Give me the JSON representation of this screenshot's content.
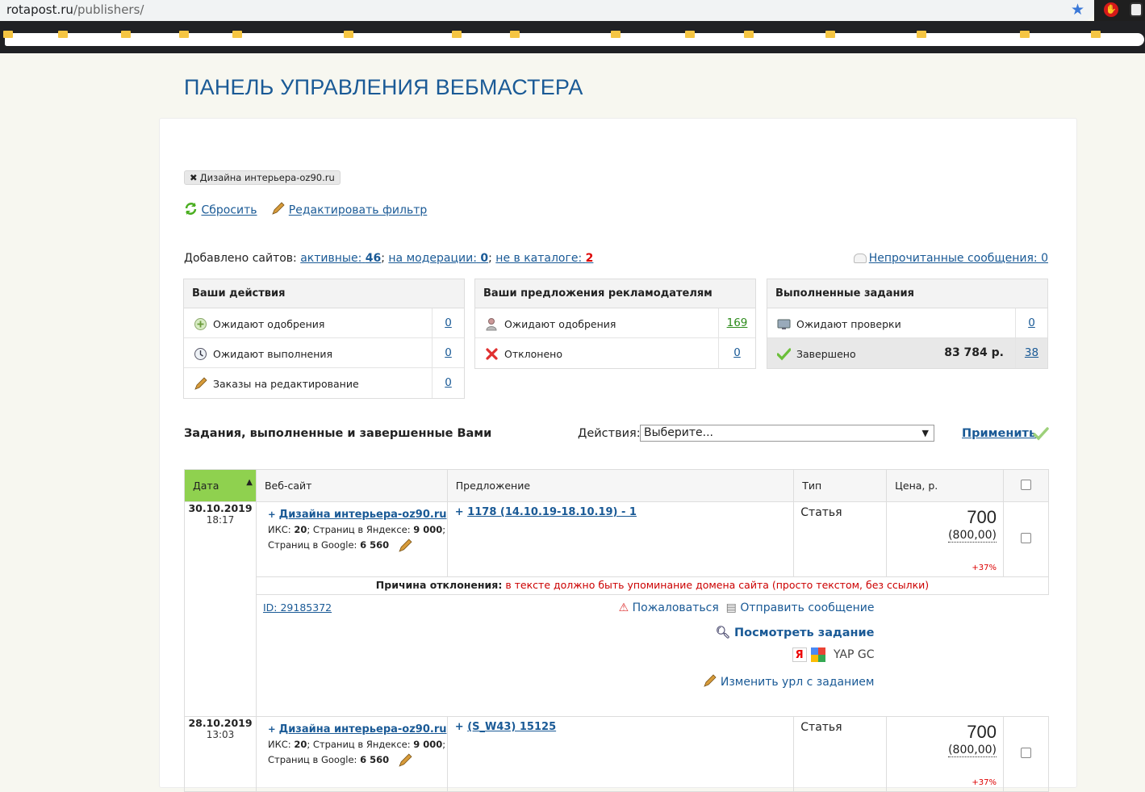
{
  "browser": {
    "url_host": "rotapost.ru",
    "url_path": "/publishers/"
  },
  "page": {
    "title": "ПАНЕЛЬ УПРАВЛЕНИЯ ВЕБМАСТЕРА"
  },
  "filter": {
    "tag": "Дизайна интерьера-oz90.ru",
    "reset": "Сбросить",
    "edit": "Редактировать фильтр"
  },
  "sites": {
    "label": "Добавлено сайтов:",
    "active_label": "активные:",
    "active_count": "46",
    "moderation_label": "на модерации:",
    "moderation_count": "0",
    "catalog_label": "не в каталоге:",
    "catalog_count": "2",
    "sep": ";"
  },
  "messages": {
    "unread": "Непрочитанные сообщения: 0"
  },
  "box_actions": {
    "title": "Ваши действия",
    "rows": [
      {
        "label": "Ожидают одобрения",
        "count": "0"
      },
      {
        "label": "Ожидают выполнения",
        "count": "0"
      },
      {
        "label": "Заказы на редактирование",
        "count": "0"
      }
    ]
  },
  "box_offers": {
    "title": "Ваши предложения рекламодателям",
    "rows": [
      {
        "label": "Ожидают одобрения",
        "count": "169"
      },
      {
        "label": "Отклонено",
        "count": "0"
      }
    ]
  },
  "box_done": {
    "title": "Выполненные задания",
    "rows": [
      {
        "label": "Ожидают проверки",
        "count": "0"
      },
      {
        "label": "Завершено",
        "sum": "83 784 р.",
        "count": "38"
      }
    ]
  },
  "tasks": {
    "heading": "Задания, выполненные и завершенные Вами",
    "actions_label": "Действия:",
    "select_value": "Выберите...",
    "apply": "Применить"
  },
  "table": {
    "columns": [
      "Дата",
      "Веб-сайт",
      "Предложение",
      "Тип",
      "Цена, р."
    ],
    "rows": [
      {
        "date": "30.10.2019",
        "time": "18:17",
        "site": "Дизайна интерьера-oz90.ru",
        "iks_label": "ИКС:",
        "iks": "20",
        "yandex_label": "Страниц в Яндексе:",
        "yandex": "9 000",
        "google_label": "Страниц в Google:",
        "google": "6 560",
        "offer": "1178 (14.10.19-18.10.19) - 1",
        "type": "Статья",
        "price": "700",
        "old_price": "(800,00)",
        "pct": "+37%",
        "reason_label": "Причина отклонения:",
        "reason": "в тексте должно быть упоминание домена сайта (просто текстом, без ссылки)",
        "id": "ID: 29185372",
        "complain": "Пожаловаться",
        "send_msg": "Отправить сообщение",
        "view": "Посмотреть задание",
        "badges_text": "YAP GC",
        "change_url": "Изменить урл с заданием"
      },
      {
        "date": "28.10.2019",
        "time": "13:03",
        "site": "Дизайна интерьера-oz90.ru",
        "iks_label": "ИКС:",
        "iks": "20",
        "yandex_label": "Страниц в Яндексе:",
        "yandex": "9 000",
        "google_label": "Страниц в Google:",
        "google": "6 560",
        "offer": "(S_W43) 15125",
        "type": "Статья",
        "price": "700",
        "old_price": "(800,00)",
        "pct": "+37%"
      }
    ]
  },
  "colors": {
    "link": "#1a5a96",
    "sort_header": "#8fd14f",
    "danger": "#d00000"
  }
}
